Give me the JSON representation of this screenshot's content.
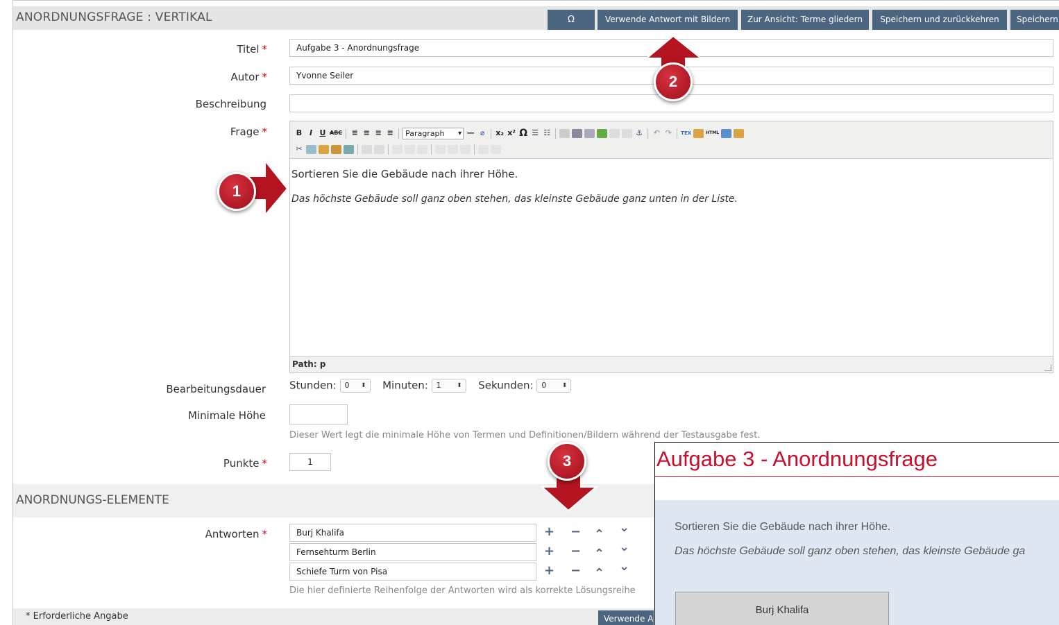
{
  "header": {
    "title": "ANORDNUNGSFRAGE : VERTIKAL",
    "buttons": {
      "omega": "Ω",
      "images": "Verwende Antwort mit Bildern",
      "terms": "Zur Ansicht: Terme gliedern",
      "save_return": "Speichern und zurückkehren",
      "save": "Speichern"
    }
  },
  "form": {
    "title_label": "Titel",
    "title_value": "Aufgabe 3 - Anordnungsfrage",
    "author_label": "Autor",
    "author_value": "Yvonne Seiler",
    "description_label": "Beschreibung",
    "description_value": "",
    "question_label": "Frage",
    "required_mark": "*"
  },
  "editor": {
    "toolbar": {
      "bold": "B",
      "italic": "I",
      "underline": "U",
      "strike": "ABC",
      "format_select": "Paragraph",
      "subscript": "x₂",
      "superscript": "x²",
      "omega": "Ω",
      "tex": "TEX",
      "html": "HTML"
    },
    "line1": "Sortieren Sie die Gebäude nach ihrer Höhe.",
    "line2": "Das höchste Gebäude soll ganz oben stehen, das kleinste Gebäude ganz unten in der Liste.",
    "path": "Path: p"
  },
  "duration": {
    "label": "Bearbeitungsdauer",
    "hours_label": "Stunden:",
    "hours_value": "0",
    "minutes_label": "Minuten:",
    "minutes_value": "1",
    "seconds_label": "Sekunden:",
    "seconds_value": "0"
  },
  "min_height": {
    "label": "Minimale Höhe",
    "value": "",
    "hint": "Dieser Wert legt die minimale Höhe von Termen und Definitionen/Bildern während der Testausgabe fest."
  },
  "points": {
    "label": "Punkte",
    "value": "1"
  },
  "section2": {
    "title": "ANORDNUNGS-ELEMENTE",
    "answers_label": "Antworten",
    "answers": [
      "Burj Khalifa",
      "Fernsehturm Berlin",
      "Schiefe Turm von Pisa"
    ],
    "controls": {
      "add": "+",
      "remove": "−",
      "up": "⌃",
      "down": "⌄"
    },
    "hint": "Die hier definierte Reihenfolge der Antworten wird als korrekte Lösungsreihe"
  },
  "footer": {
    "required_note": "* Erforderliche Angabe",
    "button": "Verwende A"
  },
  "preview": {
    "title": "Aufgabe 3 - Anordnungsfrage",
    "line1": "Sortieren Sie die Gebäude nach ihrer Höhe.",
    "line2": "Das höchste Gebäude soll ganz oben stehen, das kleinste Gebäude ga",
    "item": "Burj Khalifa"
  },
  "callouts": [
    "1",
    "2",
    "3"
  ],
  "colors": {
    "button_bg": "#4c6580",
    "required": "#d0021b",
    "callout": "#b3141f",
    "preview_accent": "#c8102e"
  }
}
